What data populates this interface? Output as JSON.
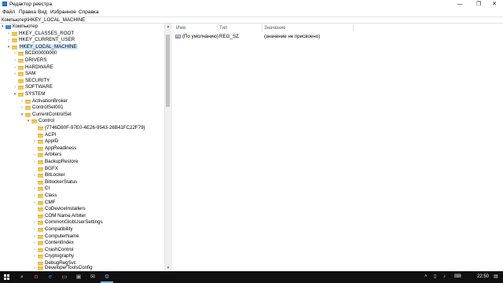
{
  "window": {
    "title": "Редактор реестра",
    "minimize": "—",
    "maximize": "❐",
    "close": "✕"
  },
  "menu": [
    "Файл",
    "Правка",
    "Вид",
    "Избранное",
    "Справка"
  ],
  "address": "Компьютер\\HKEY_LOCAL_MACHINE",
  "tree": [
    {
      "label": "Компьютер",
      "arrow": "▾",
      "icon": "computer-icon"
    },
    {
      "label": "HKEY_CLASSES_ROOT",
      "arrow": "›"
    },
    {
      "label": "HKEY_CURRENT_USER",
      "arrow": "›"
    },
    {
      "label": "HKEY_LOCAL_MACHINE",
      "arrow": "▾",
      "selected": true
    },
    {
      "label": "BCD00000000",
      "arrow": "›"
    },
    {
      "label": "DRIVERS",
      "arrow": "›"
    },
    {
      "label": "HARDWARE",
      "arrow": "›"
    },
    {
      "label": "SAM",
      "arrow": "›"
    },
    {
      "label": "SECURITY",
      "arrow": ""
    },
    {
      "label": "SOFTWARE",
      "arrow": "›"
    },
    {
      "label": "SYSTEM",
      "arrow": "▾"
    },
    {
      "label": "ActivationBroker",
      "arrow": "›"
    },
    {
      "label": "ControlSet001",
      "arrow": "›"
    },
    {
      "label": "CurrentControlSet",
      "arrow": "▾"
    },
    {
      "label": "Control",
      "arrow": "▾"
    },
    {
      "label": "{7746D80F-97E0-4E26-9543-26B41FC22F79}",
      "arrow": ""
    },
    {
      "label": "ACPI",
      "arrow": ""
    },
    {
      "label": "AppID",
      "arrow": "›"
    },
    {
      "label": "AppReadiness",
      "arrow": ""
    },
    {
      "label": "Arbiters",
      "arrow": "›"
    },
    {
      "label": "BackupRestore",
      "arrow": "›"
    },
    {
      "label": "BGFX",
      "arrow": ""
    },
    {
      "label": "BitLocker",
      "arrow": "›"
    },
    {
      "label": "BitlockerStatus",
      "arrow": ""
    },
    {
      "label": "CI",
      "arrow": "›"
    },
    {
      "label": "Class",
      "arrow": "›"
    },
    {
      "label": "CMF",
      "arrow": "›"
    },
    {
      "label": "CoDeviceInstallers",
      "arrow": ""
    },
    {
      "label": "COM Name Arbiter",
      "arrow": ""
    },
    {
      "label": "CommonGlobUserSettings",
      "arrow": "›"
    },
    {
      "label": "Compatibility",
      "arrow": "›"
    },
    {
      "label": "ComputerName",
      "arrow": "›"
    },
    {
      "label": "ContentIndex",
      "arrow": "›"
    },
    {
      "label": "CrashControl",
      "arrow": "›"
    },
    {
      "label": "Cryptography",
      "arrow": "›"
    },
    {
      "label": "DebugRegSvc",
      "arrow": ""
    },
    {
      "label": "DeveloperToolsConfig",
      "arrow": "›"
    }
  ],
  "list": {
    "headers": [
      "Имя",
      "Тип",
      "Значение"
    ],
    "rows": [
      {
        "name": "(По умолчанию)",
        "type": "REG_SZ",
        "value": "(значение не присвоено)",
        "icon": "ab"
      }
    ]
  },
  "taskbar": {
    "clock": "22:50",
    "items": [
      "search-icon",
      "task-view-icon",
      "edge-icon",
      "explorer-icon",
      "store-icon",
      "mail-icon",
      "regedit-icon"
    ]
  }
}
